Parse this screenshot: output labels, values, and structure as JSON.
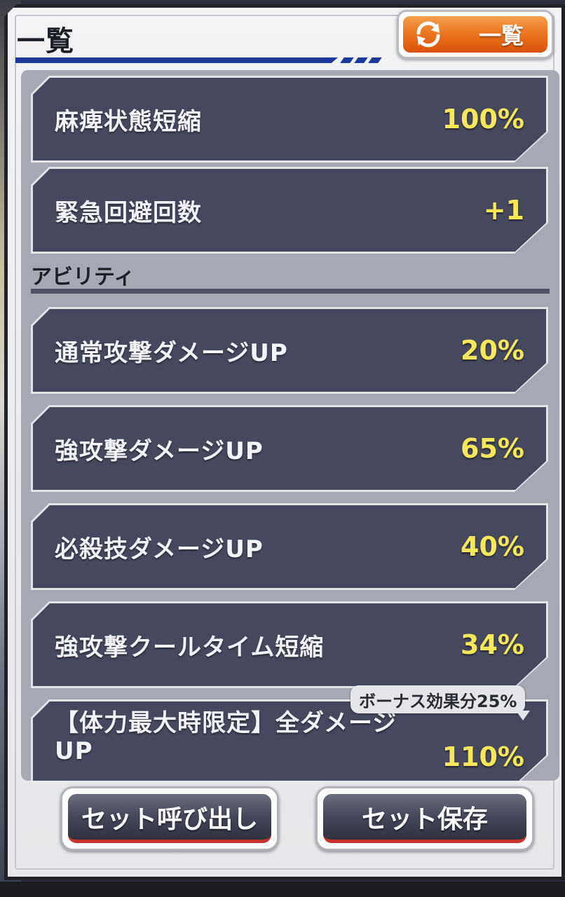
{
  "header": {
    "title": "一覧",
    "toggle_label": "一覧",
    "toggle_icon": "refresh-icon"
  },
  "rows_top": [
    {
      "label": "麻痺状態短縮",
      "value": "100%"
    },
    {
      "label": "緊急回避回数",
      "value": "+1"
    }
  ],
  "section": {
    "title": "アビリティ"
  },
  "rows_ability": [
    {
      "label": "通常攻撃ダメージUP",
      "value": "20%"
    },
    {
      "label": "強攻撃ダメージUP",
      "value": "65%"
    },
    {
      "label": "必殺技ダメージUP",
      "value": "40%"
    },
    {
      "label": "強攻撃クールタイム短縮",
      "value": "34%"
    },
    {
      "label": "【体力最大時限定】全ダメージUP",
      "value": "110%"
    }
  ],
  "bonus_badge": "ボーナス効果分25%",
  "buttons": {
    "load_set": "セット呼び出し",
    "save_set": "セット保存"
  },
  "colors": {
    "row_bg": "#46485e",
    "value_text": "#f6e85a",
    "accent_orange": "#ea6f1b",
    "header_blue": "#1c3a9c"
  }
}
